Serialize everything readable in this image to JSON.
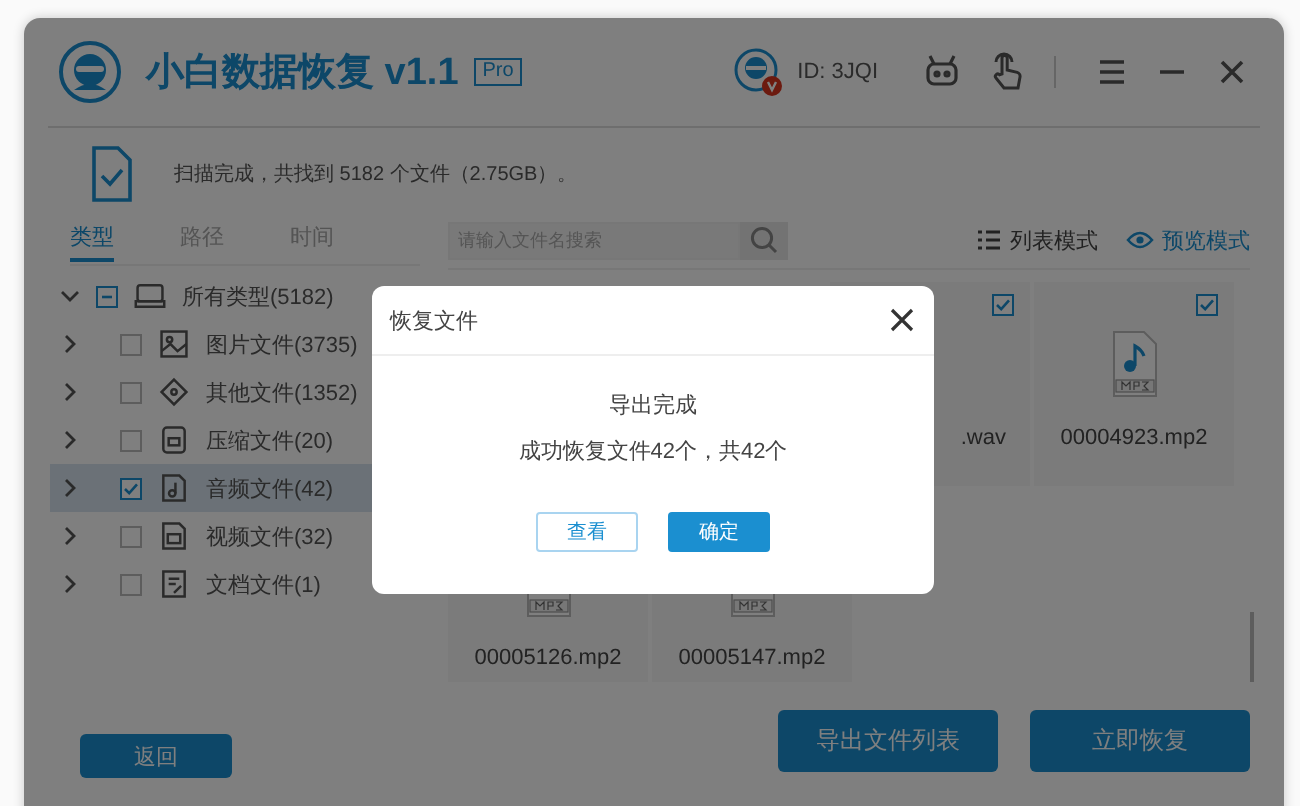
{
  "app": {
    "title": "小白数据恢复 v1.1",
    "badge": "Pro",
    "user_id": "ID: 3JQI"
  },
  "scan_summary": "扫描完成，共找到 5182 个文件（2.75GB）。",
  "tabs": [
    {
      "label": "类型",
      "selected": true
    },
    {
      "label": "路径",
      "selected": false
    },
    {
      "label": "时间",
      "selected": false
    }
  ],
  "tree": [
    {
      "label": "所有类型(5182)",
      "kind": "drive",
      "expanded": true,
      "checked": false,
      "partial": true,
      "selected": false,
      "children": [
        {
          "label": "图片文件(3735)",
          "kind": "image",
          "expanded": false,
          "checked": false,
          "partial": false,
          "selected": false
        },
        {
          "label": "其他文件(1352)",
          "kind": "other",
          "expanded": false,
          "checked": false,
          "partial": false,
          "selected": false
        },
        {
          "label": "压缩文件(20)",
          "kind": "zip",
          "expanded": false,
          "checked": false,
          "partial": false,
          "selected": false
        },
        {
          "label": "音频文件(42)",
          "kind": "audio",
          "expanded": false,
          "checked": true,
          "partial": false,
          "selected": true
        },
        {
          "label": "视频文件(32)",
          "kind": "video",
          "expanded": false,
          "checked": false,
          "partial": false,
          "selected": false
        },
        {
          "label": "文档文件(1)",
          "kind": "doc",
          "expanded": false,
          "checked": false,
          "partial": false,
          "selected": false
        }
      ]
    }
  ],
  "search": {
    "placeholder": "请输入文件名搜索"
  },
  "view_modes": [
    {
      "label": "列表模式",
      "kind": "list",
      "selected": false
    },
    {
      "label": "预览模式",
      "kind": "eye",
      "selected": true
    }
  ],
  "file_rows": [
    [
      {
        "name": ".wav",
        "checked": true,
        "icon": false
      },
      {
        "name": "00004923.mp2",
        "checked": true,
        "icon": true
      }
    ],
    [
      {
        "name": "00005126.mp2",
        "icon": true
      },
      {
        "name": "00005147.mp2",
        "icon": true
      }
    ]
  ],
  "buttons": {
    "back": "返回",
    "export_list": "导出文件列表",
    "recover": "立即恢复"
  },
  "dialog": {
    "title": "恢复文件",
    "message": "导出完成",
    "detail": "成功恢复文件42个，共42个",
    "buttons": [
      {
        "label": "查看",
        "kind": "secondary"
      },
      {
        "label": "确定",
        "kind": "primary"
      }
    ]
  }
}
